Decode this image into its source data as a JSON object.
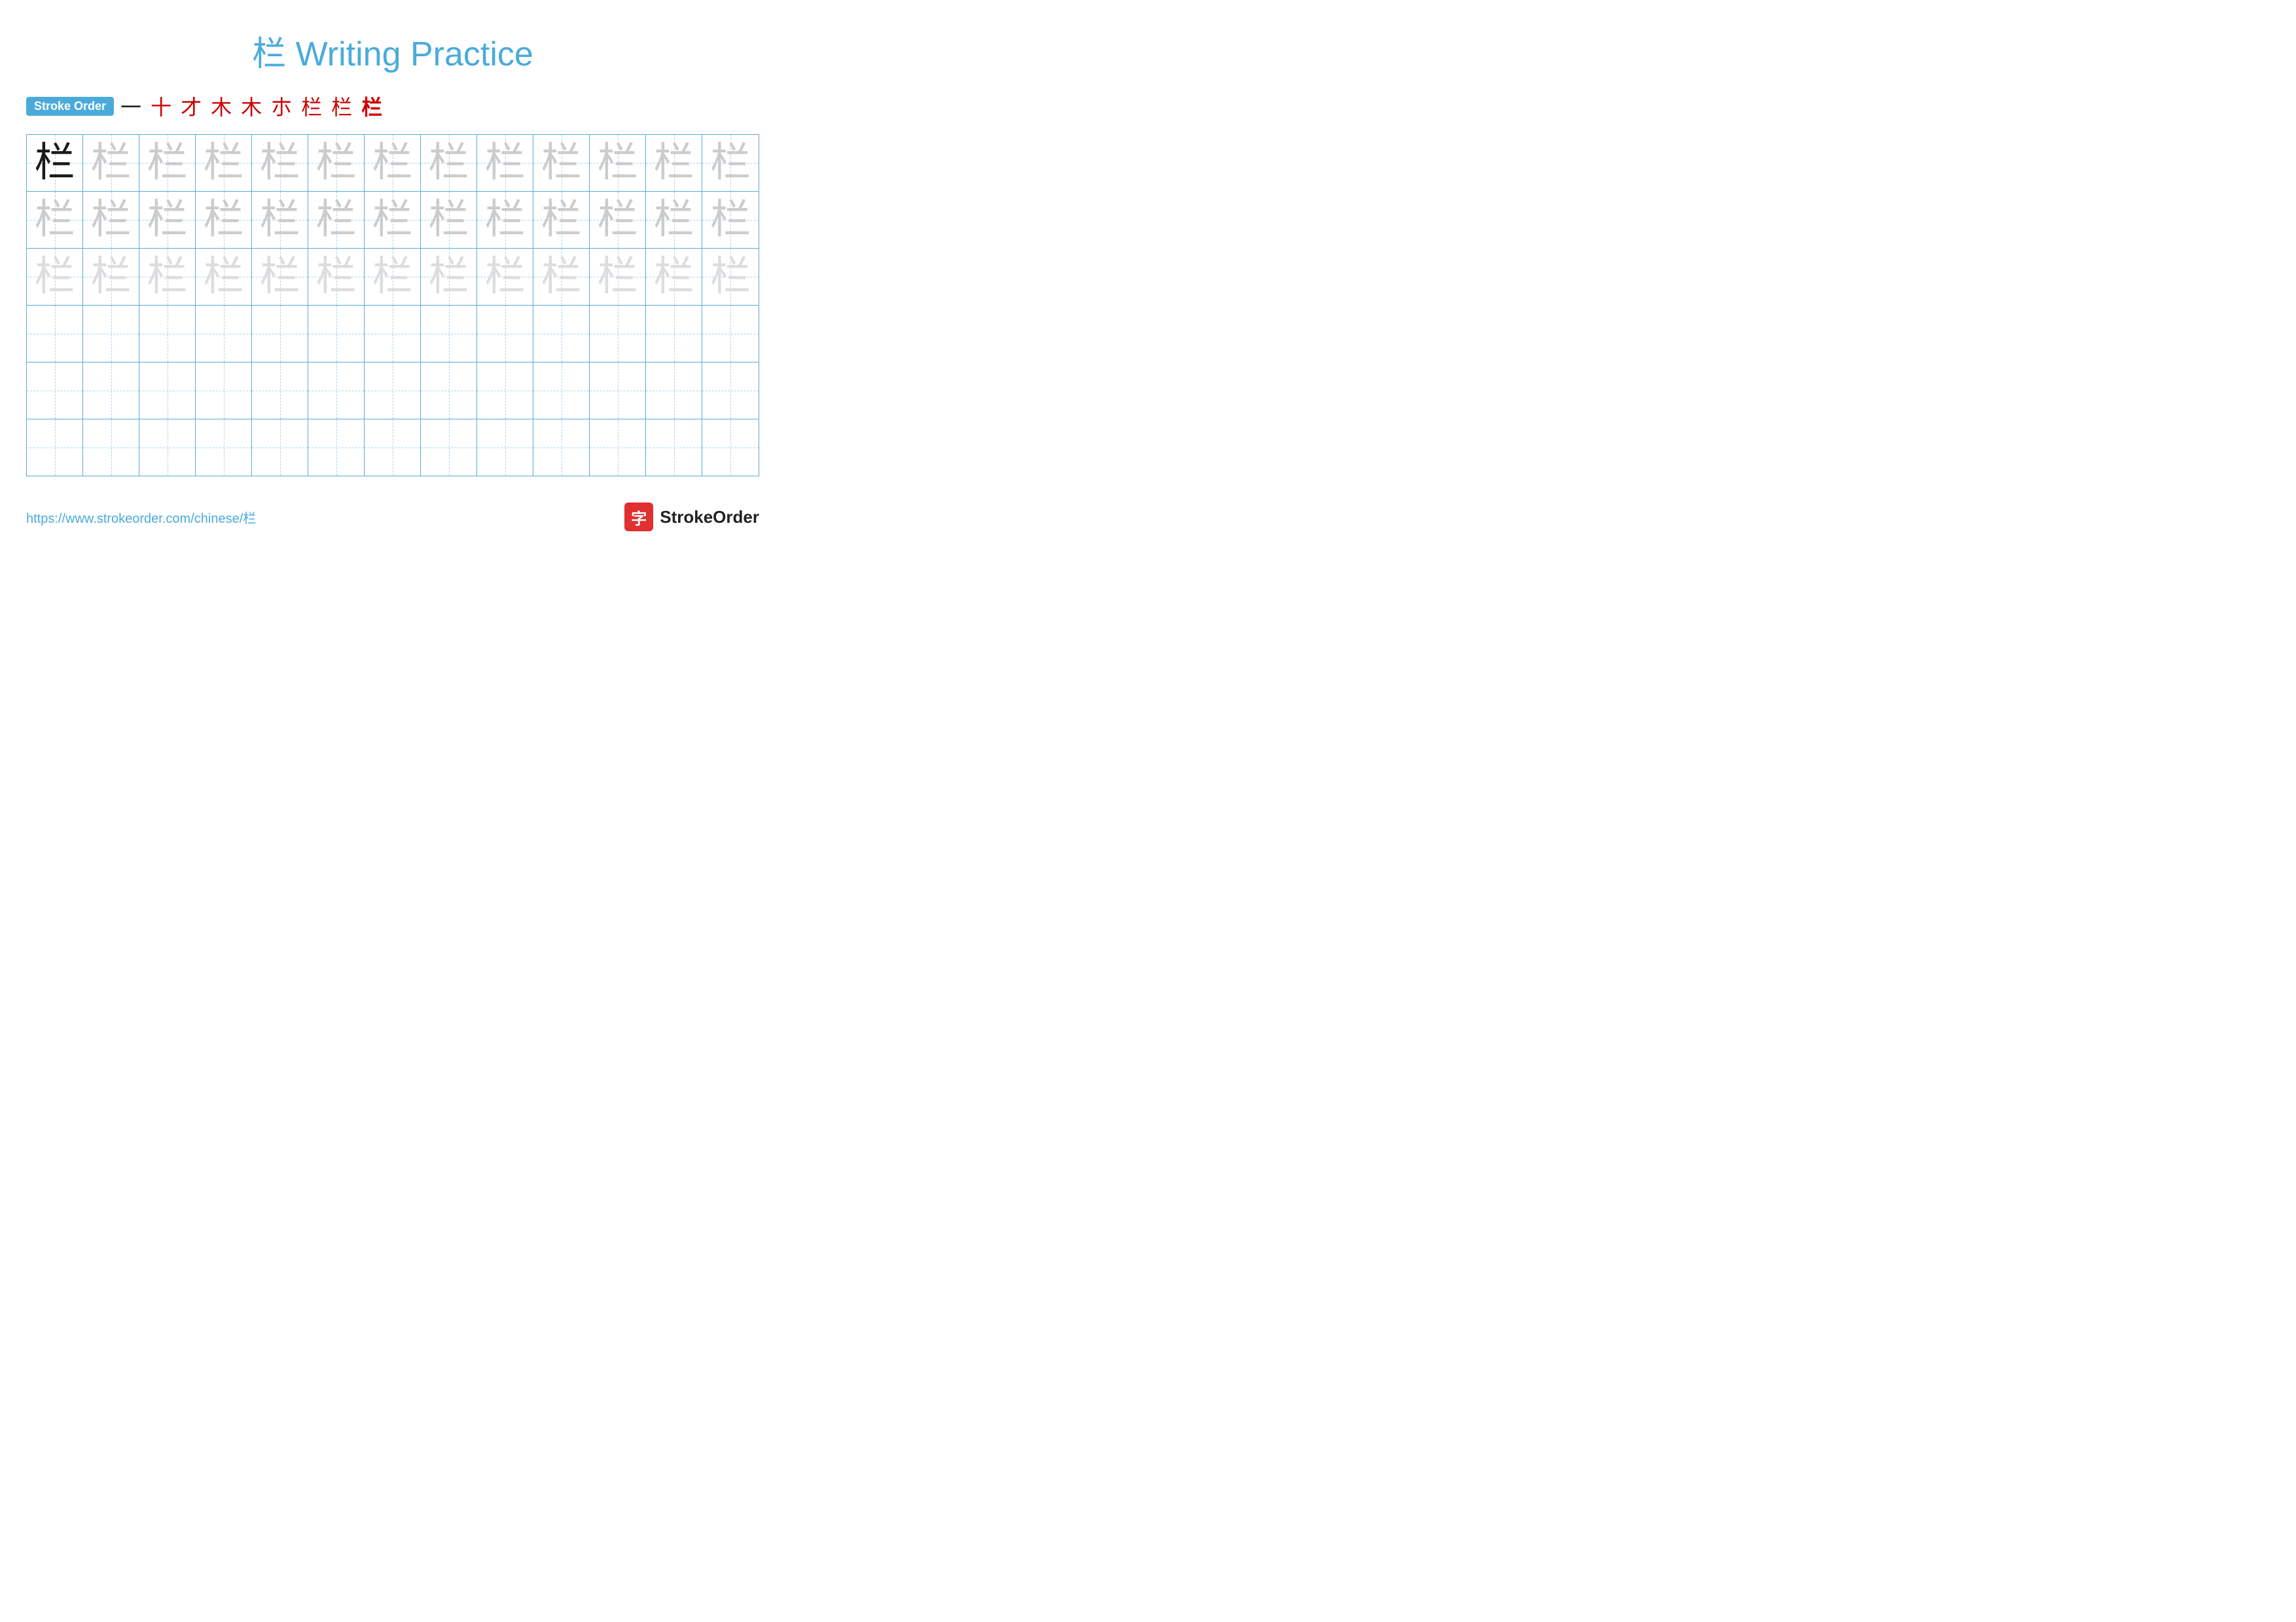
{
  "title": {
    "chinese_char": "栏",
    "text": " Writing Practice",
    "full": "栏 Writing Practice"
  },
  "stroke_order": {
    "badge_label": "Stroke Order",
    "steps": [
      "一",
      "十",
      "才",
      "木",
      "木",
      "朩",
      "栏",
      "栏",
      "栏"
    ]
  },
  "grid": {
    "rows": 6,
    "cols": 13,
    "character": "栏",
    "filled_rows": [
      {
        "type": "dark_then_light",
        "dark_count": 1
      },
      {
        "type": "light"
      },
      {
        "type": "lighter"
      },
      {
        "type": "empty"
      },
      {
        "type": "empty"
      },
      {
        "type": "empty"
      }
    ]
  },
  "footer": {
    "url": "https://www.strokeorder.com/chinese/栏",
    "brand_char": "字",
    "brand_name": "StrokeOrder"
  }
}
